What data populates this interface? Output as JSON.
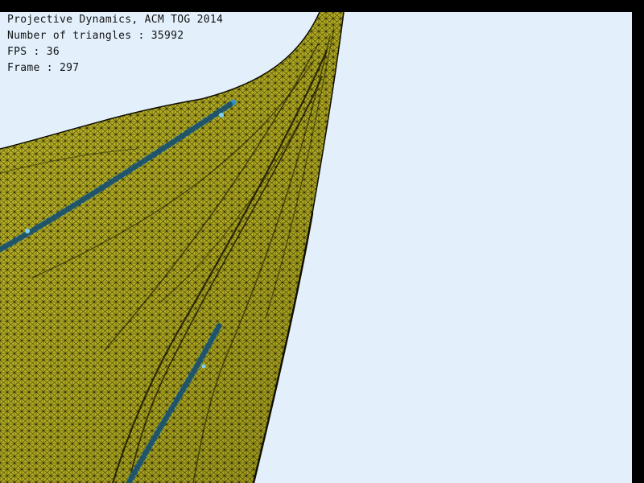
{
  "overlay": {
    "title": "Projective Dynamics, ACM TOG 2014",
    "triangles_line": "Number of triangles : 35992",
    "fps_line": "FPS : 36",
    "frame_line": "Frame : 297"
  },
  "colors": {
    "background": "#e3f0fc",
    "cloth": "#b7b024",
    "cloth_shadow": "#8f8a1b",
    "wire": "#141300",
    "accent_blue": "#2f95cf",
    "text": "#111111",
    "frame": "#000000"
  }
}
